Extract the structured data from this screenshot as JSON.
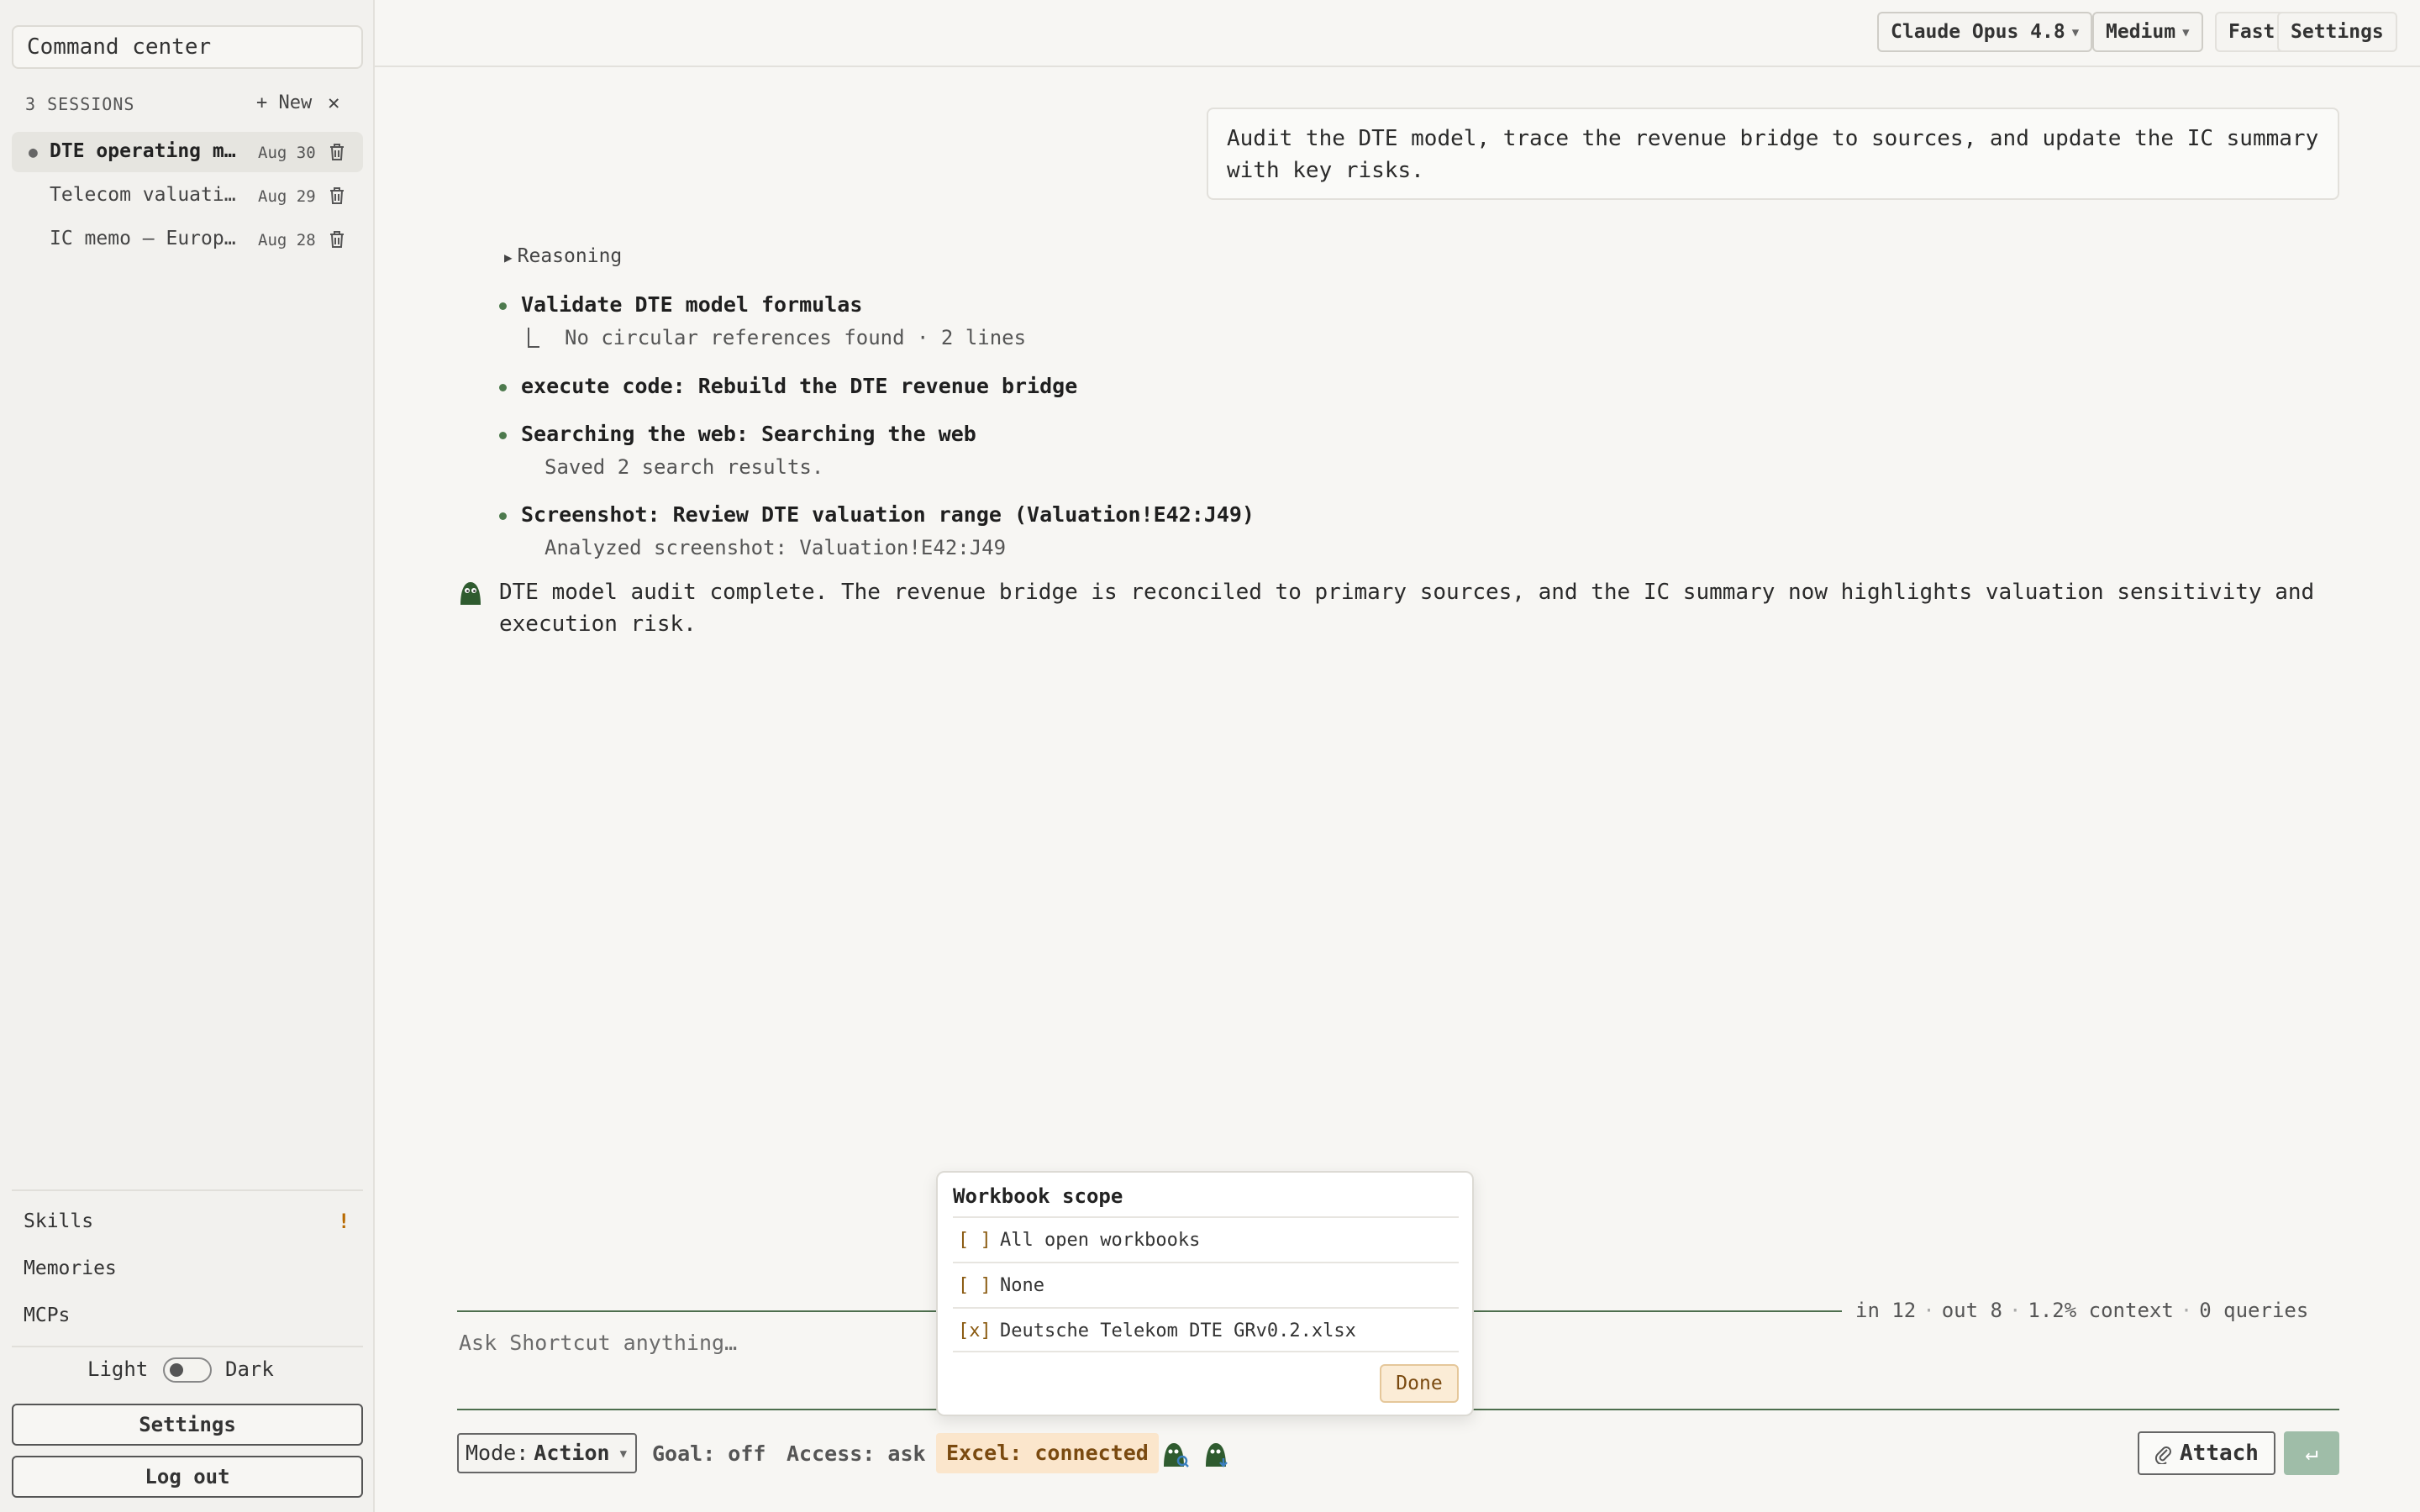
{
  "sidebar": {
    "command_center": "Command center",
    "sessions_count": "3 SESSIONS",
    "new_label": "+ New",
    "close_label": "✕",
    "sessions": [
      {
        "title": "DTE operating mo…",
        "date": "Aug 30",
        "active": true
      },
      {
        "title": "Telecom valuatio…",
        "date": "Aug 29",
        "active": false
      },
      {
        "title": "IC memo — Europe…",
        "date": "Aug 28",
        "active": false
      }
    ],
    "nav": [
      {
        "label": "Skills",
        "badge": "!"
      },
      {
        "label": "Memories"
      },
      {
        "label": "MCPs"
      }
    ],
    "theme": {
      "light": "Light",
      "dark": "Dark",
      "current": "Light"
    },
    "settings_label": "Settings",
    "logout_label": "Log out"
  },
  "topbar": {
    "model": "Claude Opus 4.8",
    "effort": "Medium",
    "fast": "Fast",
    "settings": "Settings"
  },
  "conversation": {
    "user_message": "Audit the DTE model, trace the revenue bridge to sources, and update the IC summary with key risks.",
    "reasoning_label": "Reasoning",
    "steps": [
      {
        "title": "Validate DTE model formulas",
        "detail": "No circular references found · 2 lines"
      },
      {
        "title": "execute code: Rebuild the DTE revenue bridge",
        "detail": ""
      },
      {
        "title": "Searching the web: Searching the web",
        "detail": "Saved 2 search results."
      },
      {
        "title": "Screenshot: Review DTE valuation range (Valuation!E42:J49)",
        "detail": "Analyzed screenshot: Valuation!E42:J49"
      }
    ],
    "assistant_message": "DTE model audit complete. The revenue bridge is reconciled to primary sources, and the IC summary now highlights valuation sensitivity and execution risk."
  },
  "composer": {
    "stats": {
      "in": "in 12",
      "out": "out 8",
      "context": "1.2% context",
      "queries": "0 queries"
    },
    "placeholder": "Ask Shortcut anything…",
    "mode_label": "Mode:",
    "mode_value": "Action",
    "goal": "Goal: off",
    "access": "Access: ask",
    "excel": "Excel: connected",
    "attach": "Attach",
    "send_glyph": "↵"
  },
  "workbook_scope": {
    "title": "Workbook scope",
    "options": [
      {
        "box": "[ ]",
        "label": "All open workbooks",
        "checked": false
      },
      {
        "box": "[ ]",
        "label": "None",
        "checked": false
      },
      {
        "box": "[x]",
        "label": "Deutsche Telekom DTE GRv0.2.xlsx",
        "checked": true
      }
    ],
    "done": "Done"
  },
  "colors": {
    "accent_green": "#4d7a4d",
    "excel_badge_bg": "#fbe6cc",
    "send_button": "#9fbda8"
  }
}
